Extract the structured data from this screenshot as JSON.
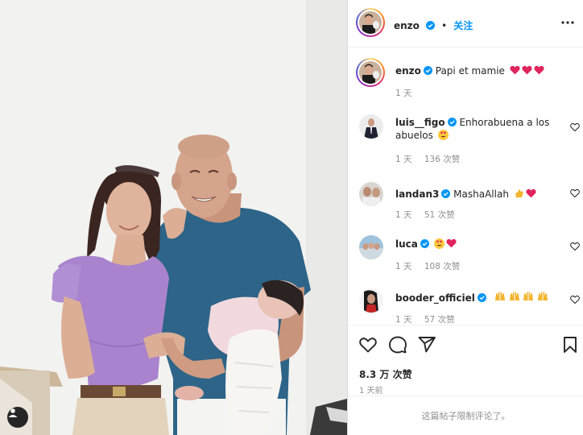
{
  "post": {
    "photo_description_alt": "",
    "tag_icon": "user-tag-icon"
  },
  "header": {
    "username": "enzo",
    "separator": "•",
    "follow_label": "关注",
    "more_icon": "more-horizontal-icon"
  },
  "caption": {
    "username": "enzo",
    "text": "Papi et mamie",
    "emojis": [
      "red-heart",
      "red-heart",
      "red-heart"
    ],
    "time": "1 天"
  },
  "comments": [
    {
      "username": "luis__figo",
      "text": "Enhorabuena a los abuelos",
      "emoji": "heart-eyes-face",
      "time": "1 天",
      "likes": "136 次赞"
    },
    {
      "username": "landan3",
      "text": "MashaAllah",
      "emoji": "thumbs-up+red-heart",
      "time": "1 天",
      "likes": "51 次赞"
    },
    {
      "username": "luca",
      "text": "",
      "emoji": "heart-eyes-face+red-heart",
      "time": "1 天",
      "likes": "108 次赞"
    },
    {
      "username": "booder_officiel",
      "text": "",
      "emoji": "raising-hands x4",
      "time": "1 天",
      "likes": "57 次赞"
    }
  ],
  "actions": {
    "like_icon": "heart-outline-icon",
    "comment_icon": "comment-bubble-icon",
    "share_icon": "paper-plane-icon",
    "save_icon": "bookmark-icon",
    "likes_count": "8.3 万 次赞",
    "time_ago": "1 天前"
  },
  "footer": {
    "restricted_text": "这篇帖子限制评论了。"
  },
  "colors": {
    "verified": "#0095f6",
    "follow": "#0095f6",
    "heart": "#e0245e",
    "muted": "#8e8e8e"
  }
}
